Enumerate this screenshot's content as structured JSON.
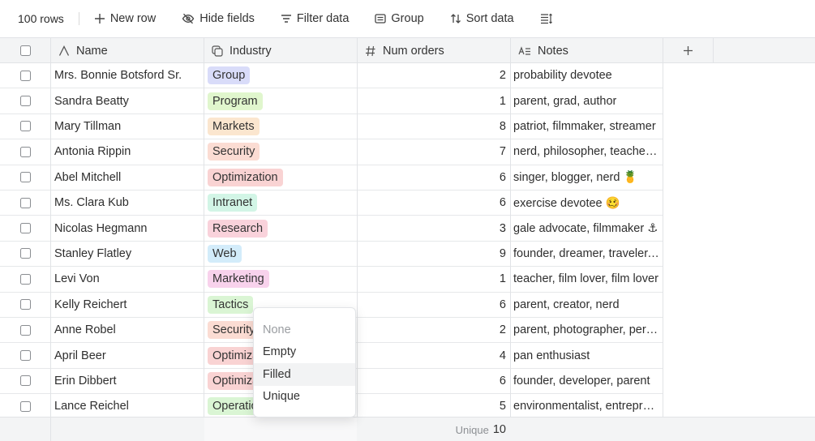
{
  "toolbar": {
    "row_count": "100 rows",
    "new_row": "New row",
    "hide_fields": "Hide fields",
    "filter_data": "Filter data",
    "group": "Group",
    "sort_data": "Sort data"
  },
  "columns": {
    "name": "Name",
    "industry": "Industry",
    "num_orders": "Num orders",
    "notes": "Notes"
  },
  "rows": [
    {
      "name": "Mrs. Bonnie Botsford Sr.",
      "industry": "Group",
      "tag_color": "#d9dcf9",
      "num": "2",
      "notes": "probability devotee"
    },
    {
      "name": "Sandra Beatty",
      "industry": "Program",
      "tag_color": "#e0f6cd",
      "num": "1",
      "notes": "parent, grad, author"
    },
    {
      "name": "Mary Tillman",
      "industry": "Markets",
      "tag_color": "#fbe6cf",
      "num": "8",
      "notes": "patriot, filmmaker, streamer"
    },
    {
      "name": "Antonia Rippin",
      "industry": "Security",
      "tag_color": "#fbdcd3",
      "num": "7",
      "notes": "nerd, philosopher, teacher, inventor"
    },
    {
      "name": "Abel Mitchell",
      "industry": "Optimization",
      "tag_color": "#f9d3d3",
      "num": "6",
      "notes": "singer, blogger, nerd 🍍"
    },
    {
      "name": "Ms. Clara Kub",
      "industry": "Intranet",
      "tag_color": "#d2f5e6",
      "num": "6",
      "notes": "exercise devotee 🥴"
    },
    {
      "name": "Nicolas Hegmann",
      "industry": "Research",
      "tag_color": "#f9d2db",
      "num": "3",
      "notes": "gale advocate, filmmaker ⚓"
    },
    {
      "name": "Stanley Flatley",
      "industry": "Web",
      "tag_color": "#d3ecfa",
      "num": "9",
      "notes": "founder, dreamer, traveler, artist"
    },
    {
      "name": "Levi Von",
      "industry": "Marketing",
      "tag_color": "#f8d2ec",
      "num": "1",
      "notes": "teacher, film lover, film lover"
    },
    {
      "name": "Kelly Reichert",
      "industry": "Tactics",
      "tag_color": "#daf5d4",
      "num": "6",
      "notes": "parent, creator, nerd"
    },
    {
      "name": "Anne Robel",
      "industry": "Security",
      "tag_color": "#fbdcd3",
      "num": "2",
      "notes": "parent, photographer, person"
    },
    {
      "name": "April Beer",
      "industry": "Optimization",
      "tag_color": "#f9d3d3",
      "num": "4",
      "notes": "pan enthusiast"
    },
    {
      "name": "Erin Dibbert",
      "industry": "Optimization",
      "tag_color": "#f9d3d3",
      "num": "6",
      "notes": "founder, developer, parent"
    },
    {
      "name": "Lance Reichel",
      "industry": "Operations",
      "tag_color": "#daf5d4",
      "num": "5",
      "notes": "environmentalist, entrepreneur"
    }
  ],
  "footer": {
    "summary_label": "Unique",
    "summary_value": "10"
  },
  "menu": {
    "items": [
      "None",
      "Empty",
      "Filled",
      "Unique"
    ]
  }
}
